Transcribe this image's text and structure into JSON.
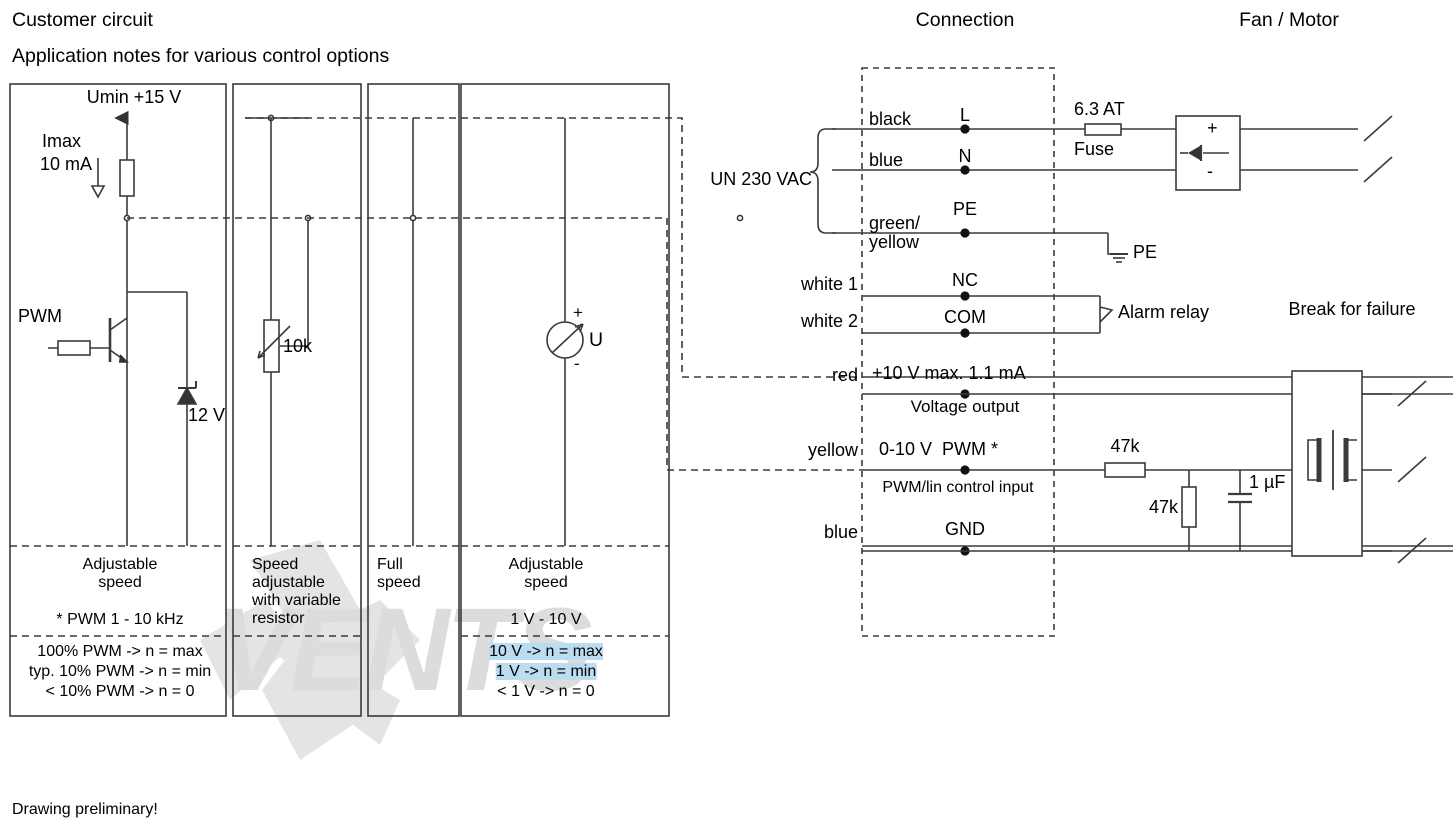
{
  "headers": {
    "customer_circuit": "Customer circuit",
    "application_notes": "Application notes for various control options",
    "connection": "Connection",
    "fan_motor": "Fan / Motor"
  },
  "footer": {
    "note": "Drawing preliminary!"
  },
  "watermark": {
    "text": "VENTS"
  },
  "panels": [
    {
      "id": "pwm",
      "supply_label": "Umin +15 V",
      "current_label_line1": "Imax",
      "current_label_line2": "10 mA",
      "input_label": "PWM",
      "zener_label": "12 V",
      "caption_line1": "Adjustable",
      "caption_line2": "speed",
      "note": "* PWM 1 - 10 kHz",
      "rules": [
        "100% PWM -> n = max",
        "typ. 10% PWM -> n = min",
        "< 10% PWM -> n = 0"
      ]
    },
    {
      "id": "potentiometer",
      "resistor_label": "10k",
      "caption_line1": "Speed",
      "caption_line2": "adjustable",
      "caption_line3": "with variable",
      "caption_line4": "resistor"
    },
    {
      "id": "full-speed",
      "caption_line1": "Full",
      "caption_line2": "speed"
    },
    {
      "id": "voltage-source",
      "source_label": "U",
      "plus": "+",
      "minus": "-",
      "caption_line1": "Adjustable",
      "caption_line2": "speed",
      "note": "1 V - 10 V",
      "rules": [
        "10 V -> n = max",
        "1 V -> n = min",
        "< 1 V -> n = 0"
      ]
    }
  ],
  "connection": {
    "mains_label": "UN 230 VAC",
    "terminals": [
      {
        "wire": "black",
        "name": "L"
      },
      {
        "wire": "blue",
        "name": "N"
      },
      {
        "wire_line1": "green/",
        "wire_line2": "yellow",
        "name": "PE"
      },
      {
        "wire": "white 1",
        "name": "NC"
      },
      {
        "wire": "white 2",
        "name": "COM"
      },
      {
        "wire": "red",
        "name": "+10 V max. 1.1 mA",
        "sub": "Voltage output"
      },
      {
        "wire": "yellow",
        "name": "0-10 V  PWM *",
        "sub": "PWM/lin control input"
      },
      {
        "wire": "blue",
        "name": "GND"
      }
    ],
    "alarm_relay": "Alarm relay",
    "pe_symbol_label": "PE"
  },
  "motor_side": {
    "fuse_rating": "6.3 AT",
    "fuse_label": "Fuse",
    "rectifier_plus": "+",
    "rectifier_minus": "-",
    "break_for_failure": "Break for failure",
    "resistor_series": "47k",
    "resistor_shunt": "47k",
    "capacitor": "1 µF"
  },
  "colors": {
    "line": "#3a3a3a",
    "text": "#000000",
    "highlight": "#bcdcf0",
    "watermark": "#e3e3e3"
  }
}
